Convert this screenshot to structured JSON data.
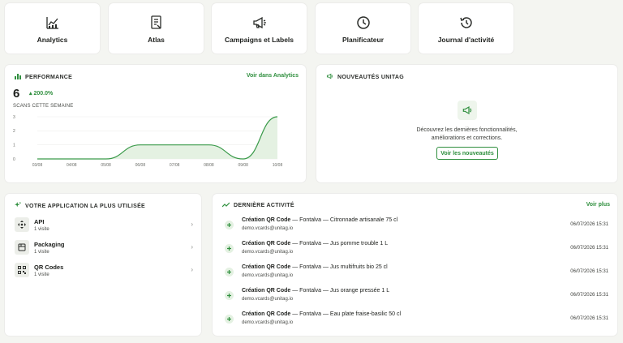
{
  "tiles": [
    {
      "label": "Analytics",
      "icon": "analytics-icon"
    },
    {
      "label": "Atlas",
      "icon": "document-icon"
    },
    {
      "label": "Campaigns et Labels",
      "icon": "megaphone-icon"
    },
    {
      "label": "Planificateur",
      "icon": "clock-icon"
    },
    {
      "label": "Journal d'activité",
      "icon": "history-icon"
    }
  ],
  "performance": {
    "title": "PERFORMANCE",
    "link": "Voir dans Analytics",
    "value": "6",
    "delta": "200.0%",
    "scans_label": "SCANS CETTE SEMAINE"
  },
  "chart_data": {
    "type": "area",
    "x": [
      "03/08",
      "04/08",
      "05/08",
      "06/08",
      "07/08",
      "08/08",
      "09/08",
      "10/08"
    ],
    "values": [
      0,
      0,
      0,
      1,
      1,
      1,
      0,
      3
    ],
    "y_ticks": [
      "0",
      "1",
      "2",
      "3"
    ],
    "ylim": [
      0,
      3
    ],
    "color": "#3a9a4a",
    "grid": true
  },
  "news": {
    "title": "NOUVEAUTÉS UNITAG",
    "line1": "Découvrez les dernières fonctionnalités,",
    "line2": "améliorations et corrections.",
    "button": "Voir les nouveautés"
  },
  "apps": {
    "title": "VOTRE APPLICATION LA PLUS UTILISÉE",
    "items": [
      {
        "name": "API",
        "visits": "1 visite",
        "icon": "move-icon"
      },
      {
        "name": "Packaging",
        "visits": "1 visite",
        "icon": "package-icon"
      },
      {
        "name": "QR Codes",
        "visits": "1 visite",
        "icon": "qr-code-icon"
      }
    ]
  },
  "activity": {
    "title": "DERNIÈRE ACTIVITÉ",
    "link": "Voir plus",
    "items": [
      {
        "action": "Création QR Code",
        "detail": " — Fontalva — Citronnade artisanale 75 cl",
        "user": "demo.vcards@unitag.io",
        "date": "06/07/2026 15:31"
      },
      {
        "action": "Création QR Code",
        "detail": " — Fontalva — Jus pomme trouble 1 L",
        "user": "demo.vcards@unitag.io",
        "date": "06/07/2026 15:31"
      },
      {
        "action": "Création QR Code",
        "detail": " — Fontalva — Jus multifruits bio 25 cl",
        "user": "demo.vcards@unitag.io",
        "date": "06/07/2026 15:31"
      },
      {
        "action": "Création QR Code",
        "detail": " — Fontalva — Jus orange pressée 1 L",
        "user": "demo.vcards@unitag.io",
        "date": "06/07/2026 15:31"
      },
      {
        "action": "Création QR Code",
        "detail": " — Fontalva — Eau plate fraise-basilic 50 cl",
        "user": "demo.vcards@unitag.io",
        "date": "06/07/2026 15:31"
      }
    ]
  }
}
